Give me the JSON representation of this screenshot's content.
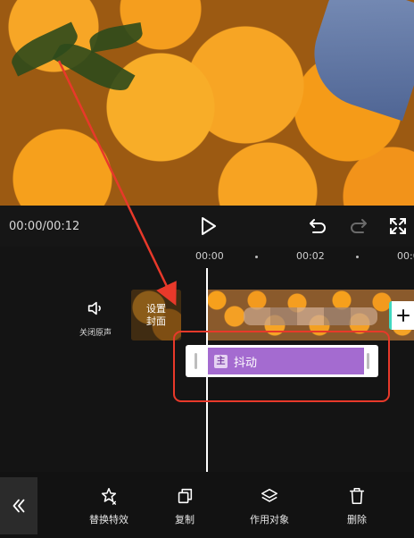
{
  "playback": {
    "time": "00:00/00:12"
  },
  "ruler": {
    "labels": [
      "00:00",
      "00:02",
      "00:0"
    ]
  },
  "mute": {
    "label": "关闭原声"
  },
  "cover": {
    "label": "设置封面"
  },
  "effect": {
    "tag": "主",
    "name": "抖动",
    "color": "#a46bd0"
  },
  "toolbar": {
    "items": [
      {
        "label": "替换特效",
        "icon": "replace-effect-icon"
      },
      {
        "label": "复制",
        "icon": "copy-icon"
      },
      {
        "label": "作用对象",
        "icon": "layers-icon"
      },
      {
        "label": "删除",
        "icon": "trash-icon"
      }
    ]
  },
  "colors": {
    "annotation": "#e8392a",
    "accent": "#3fd8c0"
  }
}
